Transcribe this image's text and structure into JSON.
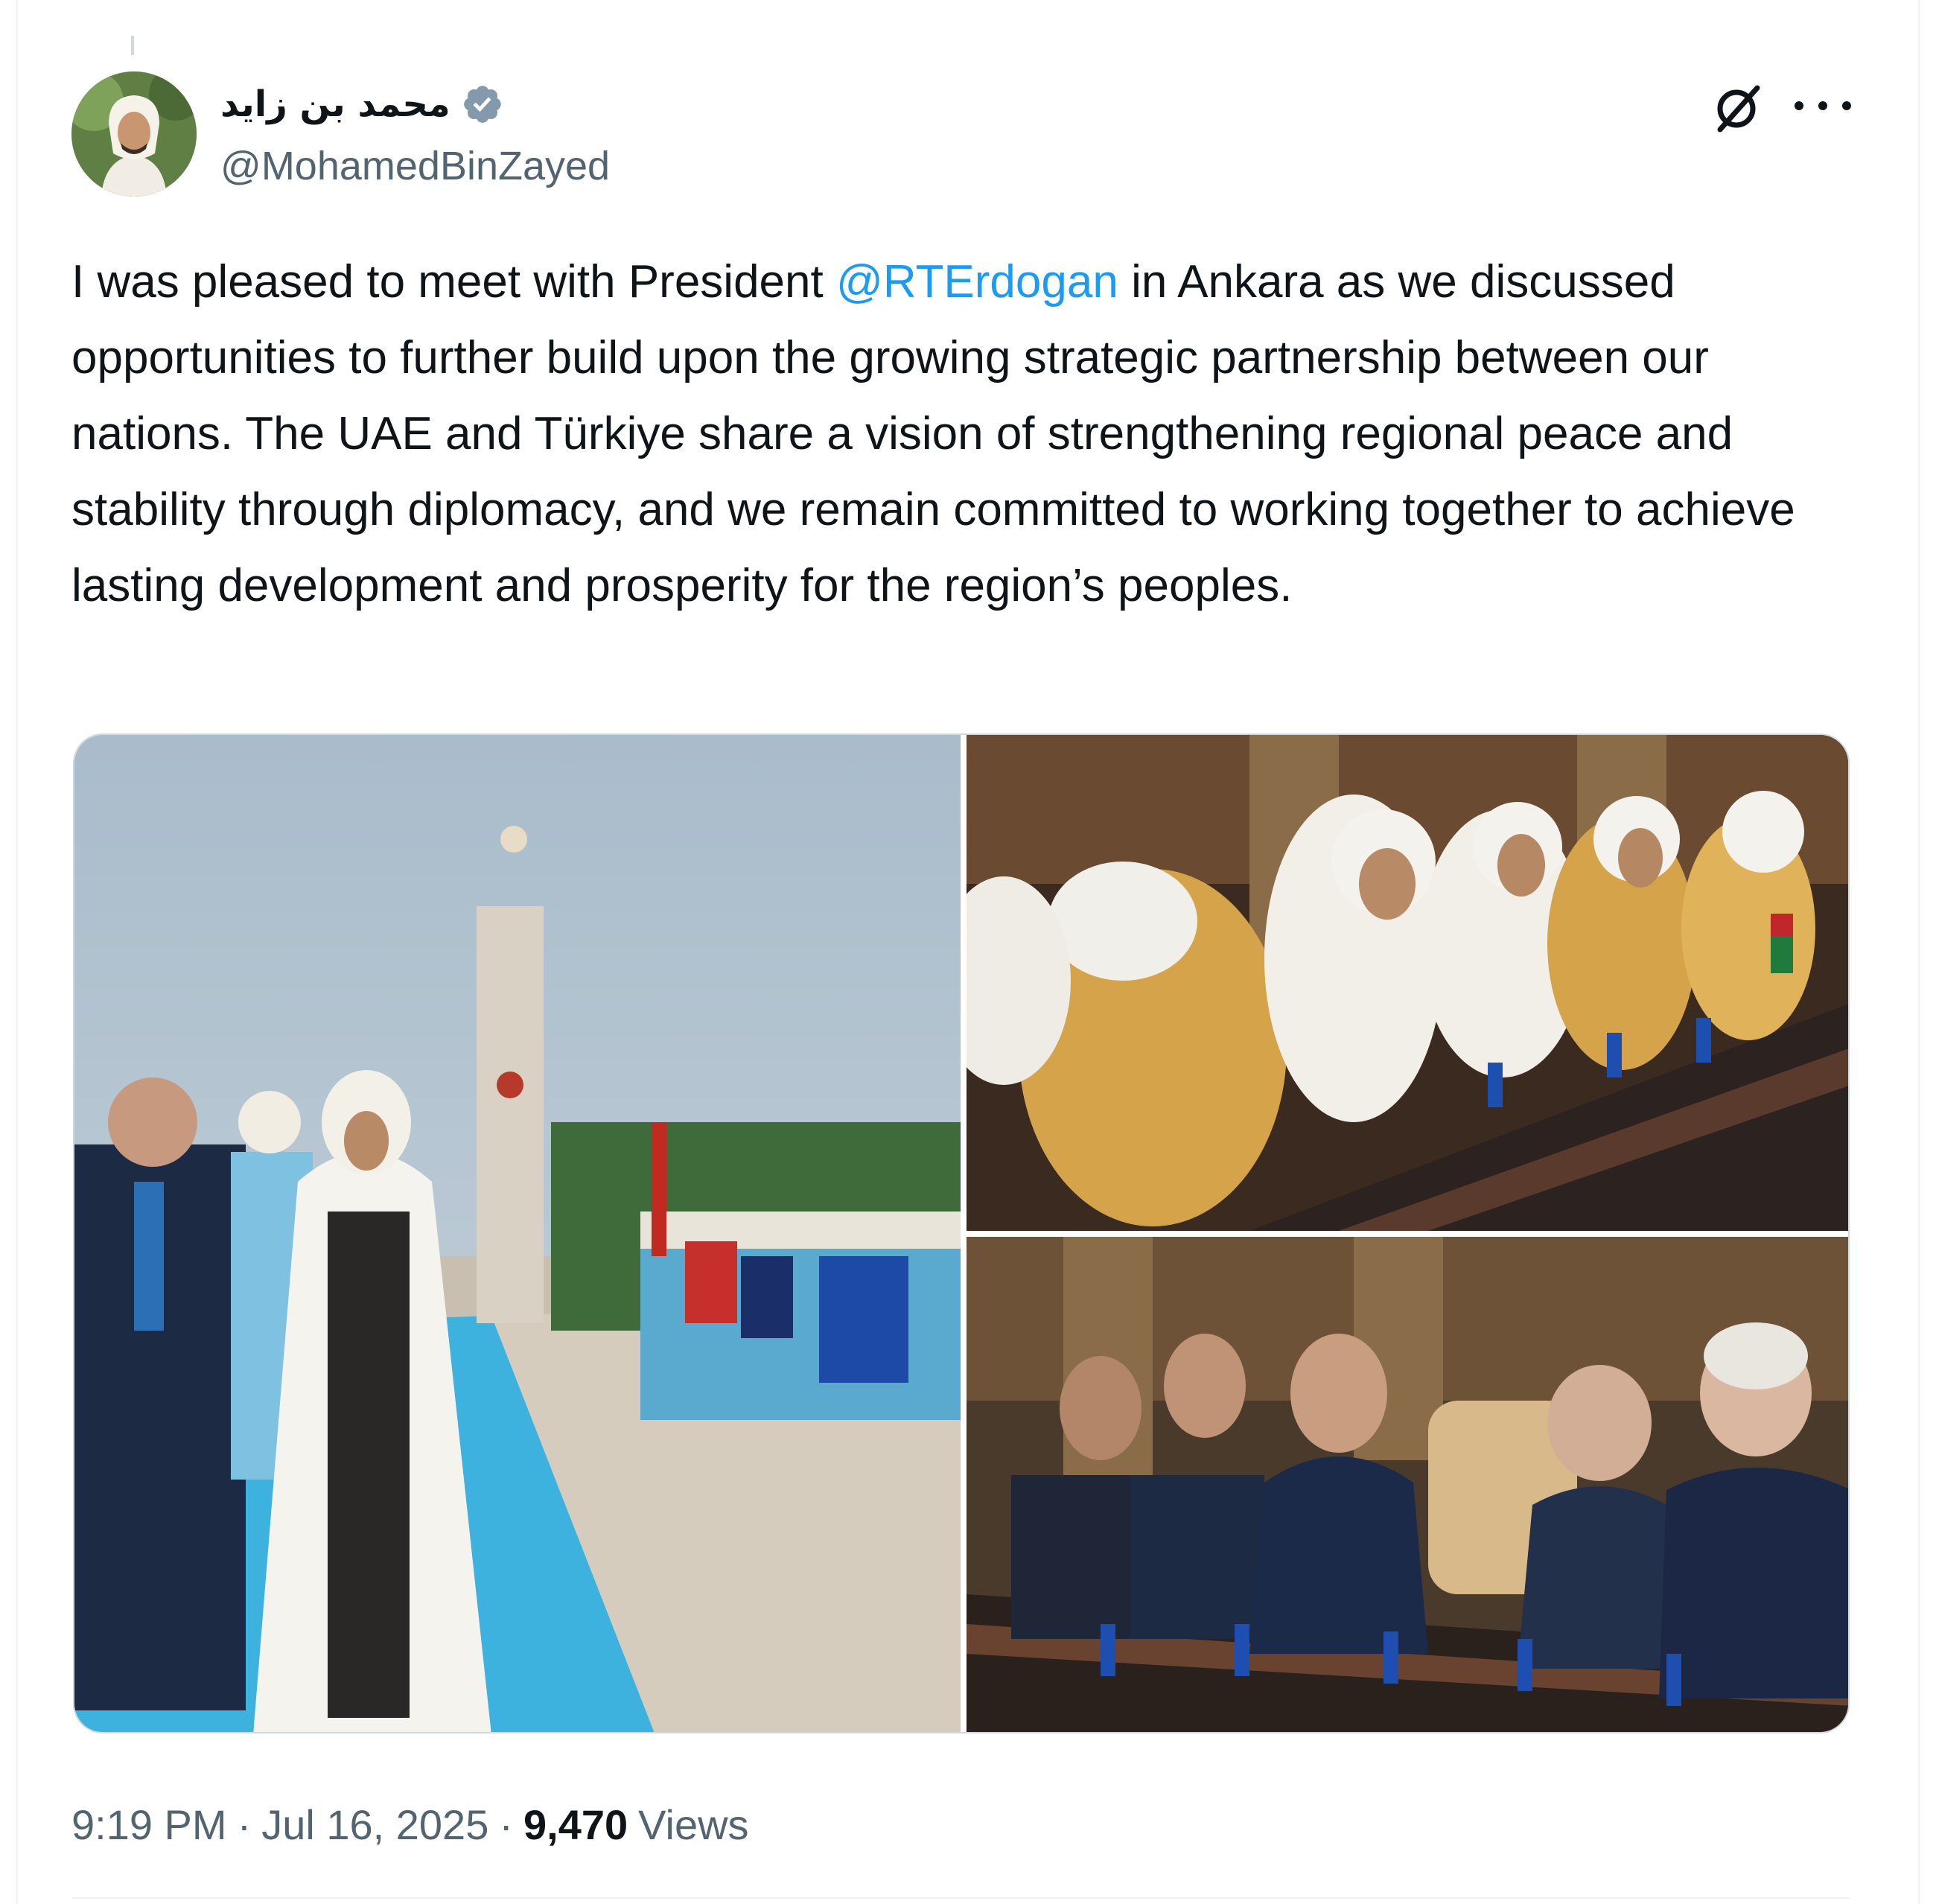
{
  "tweet": {
    "display_name": "محمد بن زايد",
    "handle": "@MohamedBinZayed",
    "text": {
      "before_mention": "I was pleased to meet with President ",
      "mention": "@RTErdogan",
      "after_mention": " in Ankara as we discussed opportunities to further build upon the growing strategic partnership between our nations. The UAE and Türkiye share a vision of strengthening regional peace and stability through diplomacy, and we remain committed to working together to achieve lasting development and prosperity for the region’s peoples."
    },
    "time": "9:19 PM",
    "separator": "·",
    "date": "Jul 16, 2025",
    "views_count": "9,470",
    "views_label": "Views"
  },
  "icons": {
    "verified": "verified-badge-icon",
    "grok": "grok-icon",
    "more": "more-options-icon"
  },
  "colors": {
    "text": "#0f1419",
    "secondary": "#536471",
    "mention": "#1d9bf0",
    "verified_badge": "#829aab"
  }
}
